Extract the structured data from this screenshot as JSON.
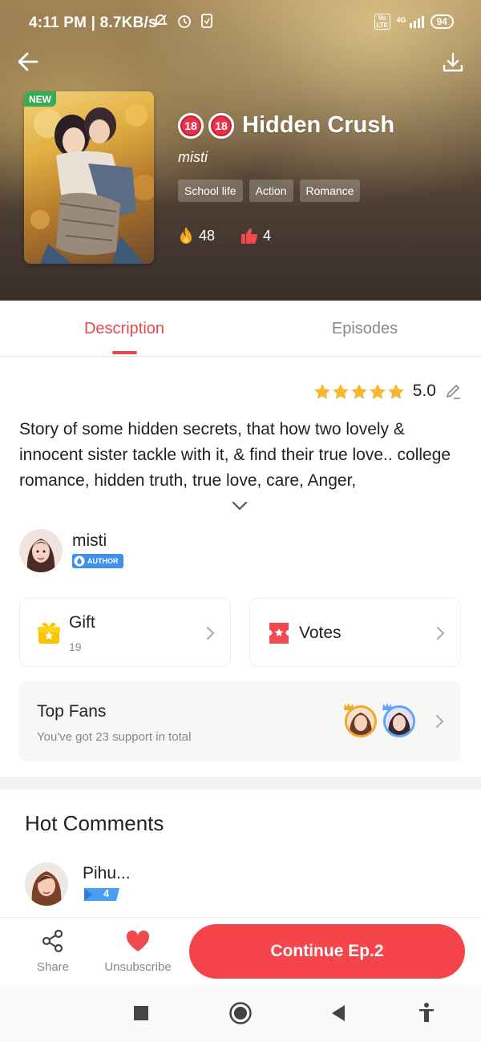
{
  "status_bar": {
    "time_speed": "4:11 PM | 8.7KB/s",
    "network": "4G",
    "volte": "Vo LTE",
    "battery": "94"
  },
  "hero": {
    "cover_badge": "NEW",
    "age_rating": "18",
    "title": "Hidden Crush",
    "author": "misti",
    "tags": [
      "School life",
      "Action",
      "Romance"
    ],
    "popularity": "48",
    "likes": "4"
  },
  "tabs": {
    "description": "Description",
    "episodes": "Episodes"
  },
  "rating": {
    "value": "5.0",
    "stars": 5
  },
  "description_text": "Story of some hidden secrets, that how two lovely & innocent sister tackle with it, & find their true love.. college romance, hidden truth, true love, care, Anger,",
  "author_row": {
    "name": "misti",
    "badge": "AUTHOR"
  },
  "gift_card": {
    "title": "Gift",
    "count": "19"
  },
  "votes_card": {
    "title": "Votes"
  },
  "top_fans": {
    "title": "Top Fans",
    "subtitle": "You've got 23 support in total"
  },
  "comments": {
    "title": "Hot Comments",
    "first_user": "Pihu...",
    "first_level": "4"
  },
  "action_bar": {
    "share": "Share",
    "unsubscribe": "Unsubscribe",
    "continue": "Continue Ep.2"
  },
  "colors": {
    "accent": "#f5444a",
    "tab_active": "#e9474d",
    "star": "#f7b731",
    "tag_bg": "rgba(255,255,255,0.22)",
    "new_badge": "#3aa957",
    "author_badge": "#3e90ec"
  }
}
